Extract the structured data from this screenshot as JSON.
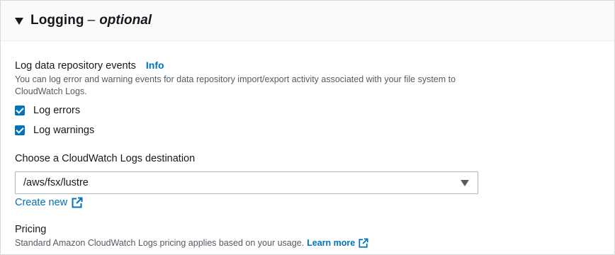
{
  "header": {
    "title": "Logging",
    "separator": "–",
    "optional": "optional"
  },
  "repository_events": {
    "label": "Log data repository events",
    "info_link": "Info",
    "description": "You can log error and warning events for data repository import/export activity associated with your file system to CloudWatch Logs.",
    "checkboxes": [
      {
        "label": "Log errors",
        "checked": true
      },
      {
        "label": "Log warnings",
        "checked": true
      }
    ]
  },
  "destination": {
    "label": "Choose a CloudWatch Logs destination",
    "selected_value": "/aws/fsx/lustre",
    "create_new_label": "Create new"
  },
  "pricing": {
    "label": "Pricing",
    "description": "Standard Amazon CloudWatch Logs pricing applies based on your usage.",
    "learn_more_label": "Learn more"
  },
  "colors": {
    "accent": "#0073bb",
    "text": "#16191f",
    "muted": "#545b64",
    "header_bg": "#fafafa"
  }
}
